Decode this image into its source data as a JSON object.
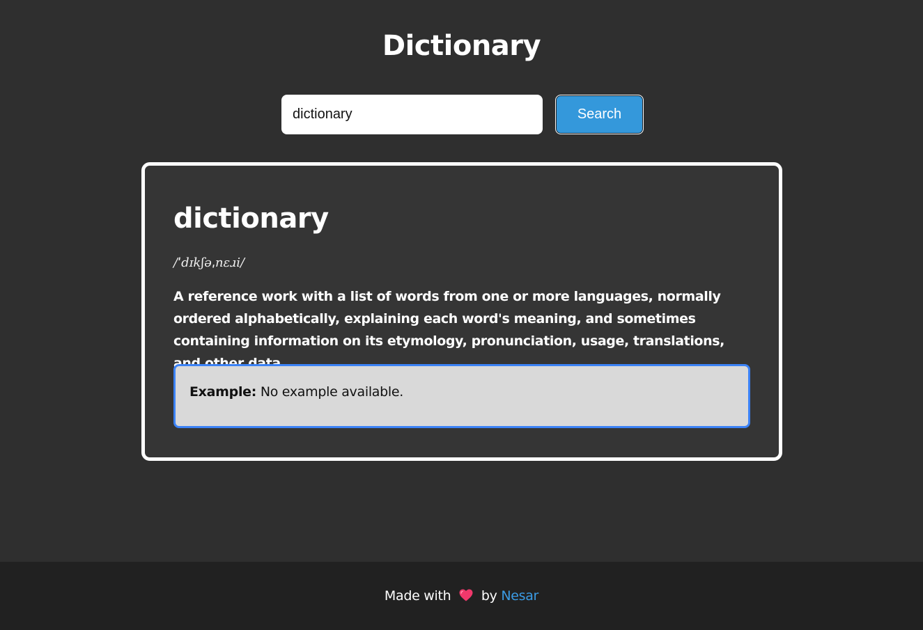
{
  "header": {
    "title": "Dictionary"
  },
  "search": {
    "value": "dictionary",
    "button_label": "Search"
  },
  "result": {
    "word": "dictionary",
    "phonetic": "/ˈdɪkʃəˌnɛɹi/",
    "definition": "A reference work with a list of words from one or more languages, normally ordered alphabetically, explaining each word's meaning, and sometimes containing information on its etymology, pronunciation, usage, translations, and other data.",
    "example_label": "Example:",
    "example_text": "No example available."
  },
  "footer": {
    "made_with": "Made with",
    "by": "by",
    "author": "Nesar",
    "heart_icon": "heart-icon"
  },
  "colors": {
    "background": "#2f2f2f",
    "card_background": "#353535",
    "accent": "#3498db",
    "link": "#3b9ce5",
    "example_border": "#3b82f6",
    "footer_background": "#212121"
  }
}
